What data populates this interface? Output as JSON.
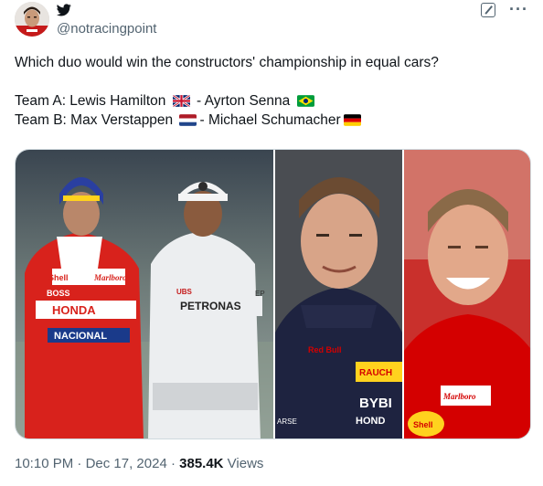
{
  "author": {
    "handle": "@notracingpoint",
    "avatar_icon": "avatar-driver-icon",
    "platform_icon": "twitter-bird-icon"
  },
  "actions": {
    "grok_icon": "grok-icon",
    "more_icon": "more-dots-icon"
  },
  "tweet": {
    "question": "Which duo would win the constructors' championship in equal cars?",
    "team_a_prefix": "Team A: Lewis Hamilton",
    "team_a_separator": "- Ayrton Senna",
    "team_b_prefix": "Team B: Max Verstappen",
    "team_b_separator": "- Michael Schumacher",
    "flags": [
      "uk-flag-icon",
      "brazil-flag-icon",
      "netherlands-flag-icon",
      "germany-flag-icon"
    ]
  },
  "media": {
    "photo_left_labels": {
      "senna_sponsor_shell": "Shell",
      "senna_sponsor_boss": "BOSS",
      "senna_sponsor_marlboro": "Marlboro",
      "senna_sponsor_honda": "HONDA",
      "senna_sponsor_nacional": "NACIONAL",
      "hamilton_sponsor_petronas": "PETRONAS",
      "hamilton_sponsor_ubs": "UBS",
      "hamilton_sponsor_ep": "EP"
    },
    "photo_middle_labels": {
      "redbull": "Red Bull",
      "bybit": "BYBI",
      "honda": "HOND",
      "rauch": "RAUCH",
      "oracle_left": "ARSE"
    },
    "photo_right_labels": {
      "marlboro": "Marlboro",
      "shell": "Shell"
    }
  },
  "meta": {
    "time": "10:10 PM",
    "separator": " · ",
    "date": "Dec 17, 2024",
    "views_count": "385.4K",
    "views_label": " Views"
  },
  "colors": {
    "text_primary": "#0f1419",
    "text_secondary": "#536471",
    "border": "#cfd9de",
    "ferrari_red": "#d40000",
    "redbull_navy": "#1e2340"
  }
}
